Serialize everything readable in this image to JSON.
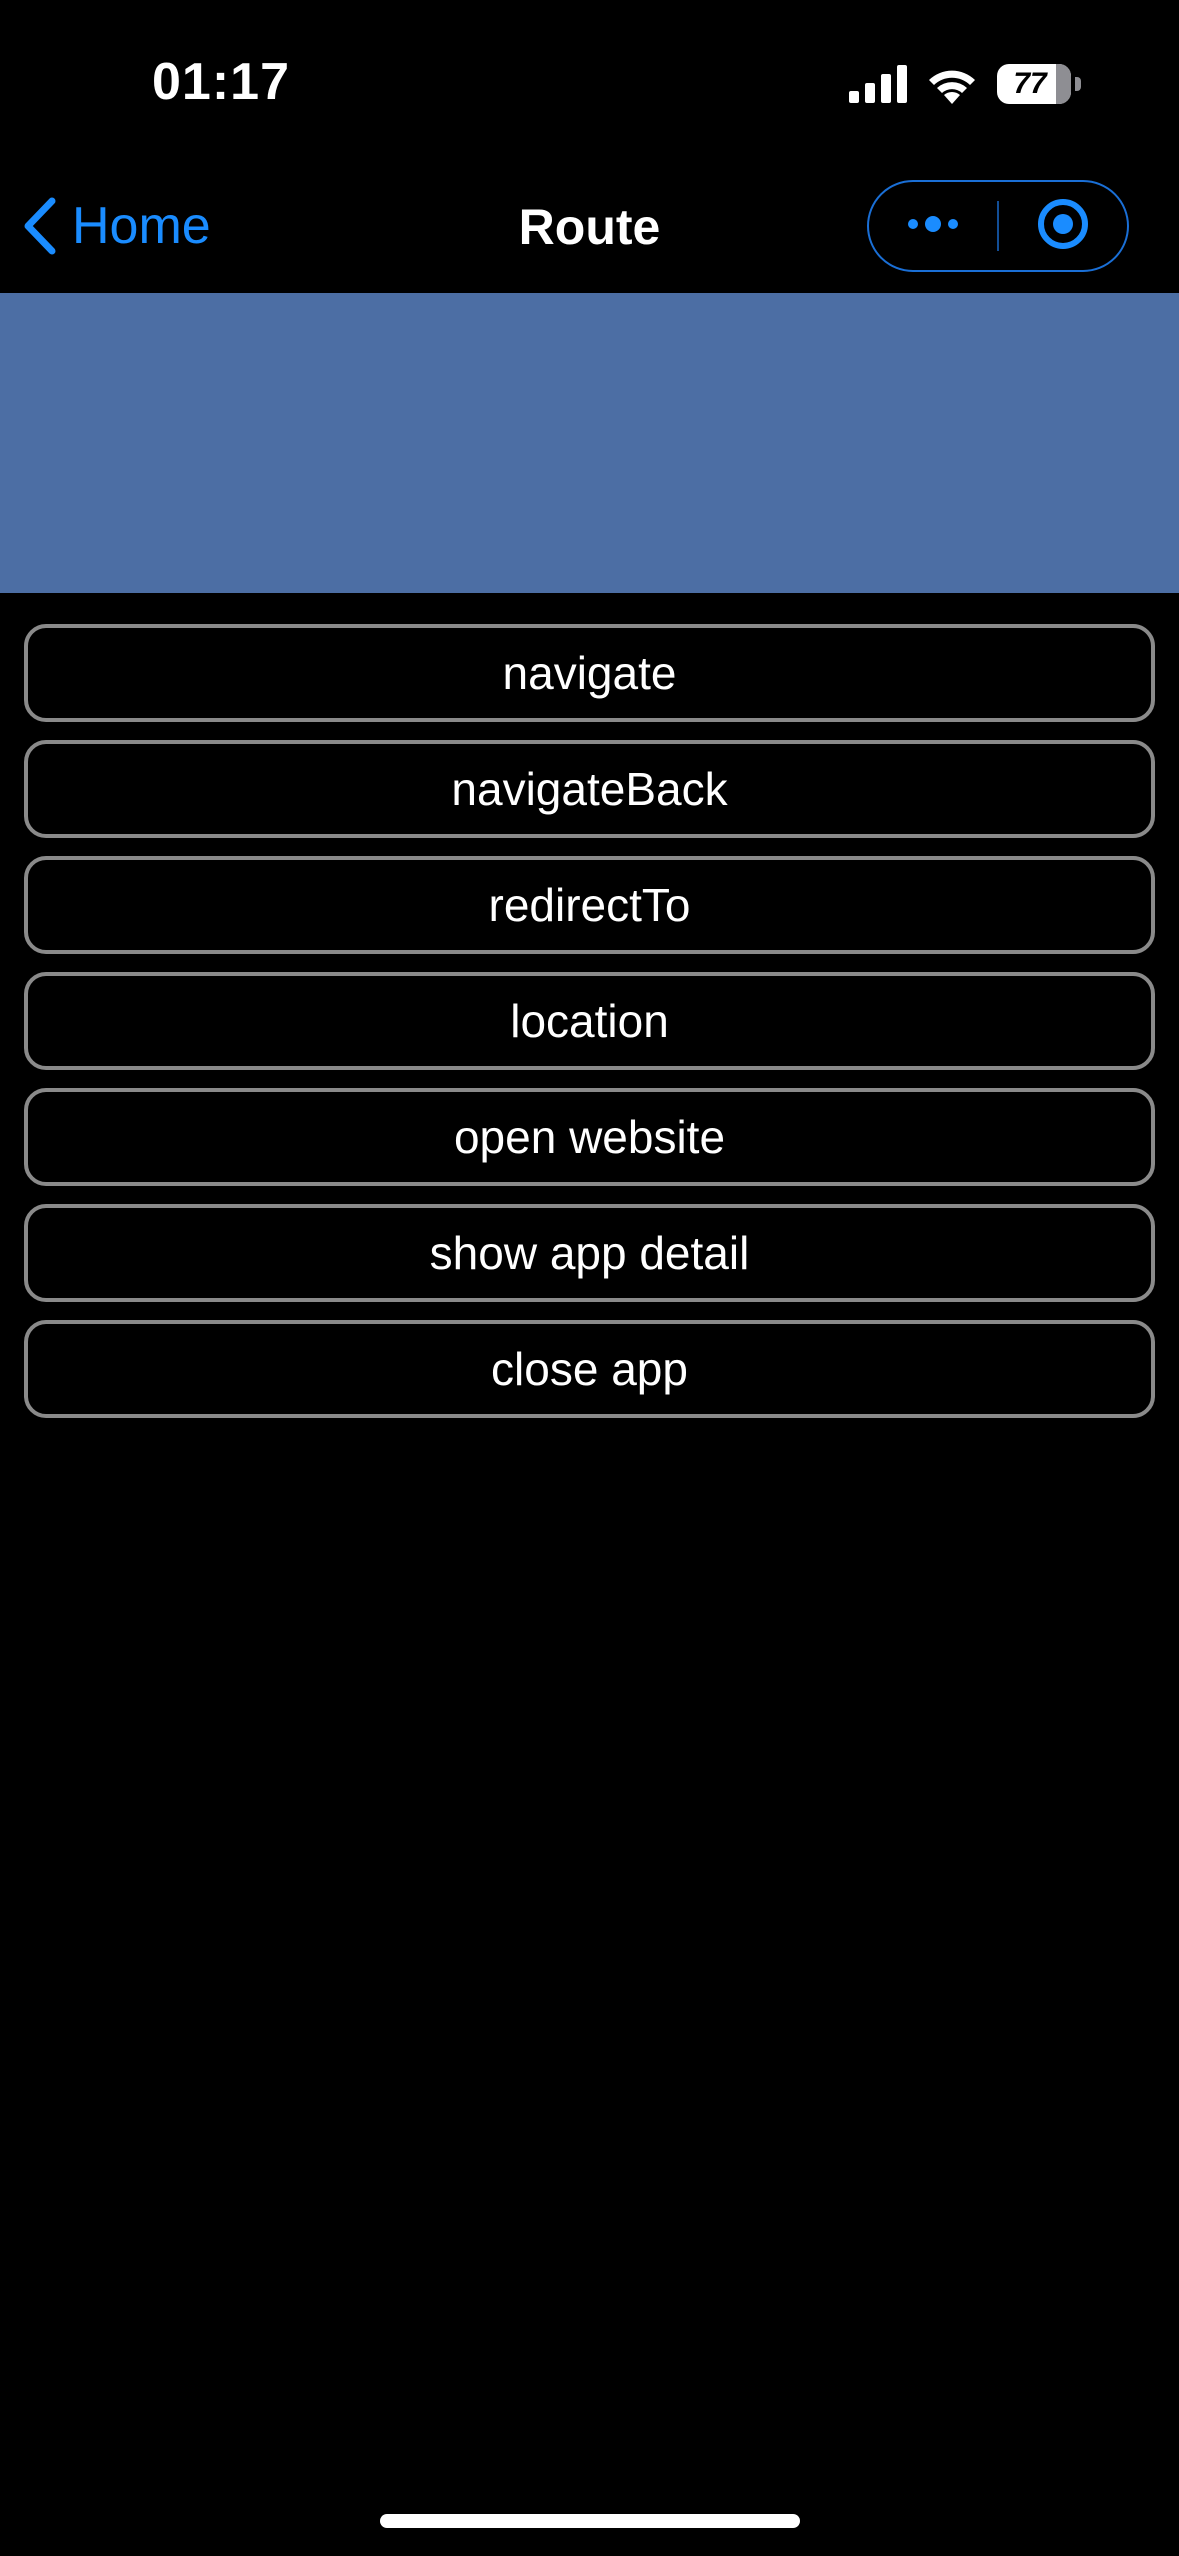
{
  "status_bar": {
    "time": "01:17",
    "battery_level": "77",
    "signal_icon": "cellular-signal-icon",
    "wifi_icon": "wifi-icon",
    "battery_icon": "battery-icon"
  },
  "nav": {
    "back_label": "Home",
    "back_icon": "chevron-left-icon",
    "title": "Route",
    "more_icon": "more-dots-icon",
    "close_icon": "target-close-icon"
  },
  "colors": {
    "accent": "#1a8cff",
    "banner": "#4c6ea4",
    "button_border": "#8a8a8a",
    "background": "#000000"
  },
  "buttons": [
    {
      "label": "navigate"
    },
    {
      "label": "navigateBack"
    },
    {
      "label": "redirectTo"
    },
    {
      "label": "location"
    },
    {
      "label": "open website"
    },
    {
      "label": "show app detail"
    },
    {
      "label": "close app"
    }
  ]
}
